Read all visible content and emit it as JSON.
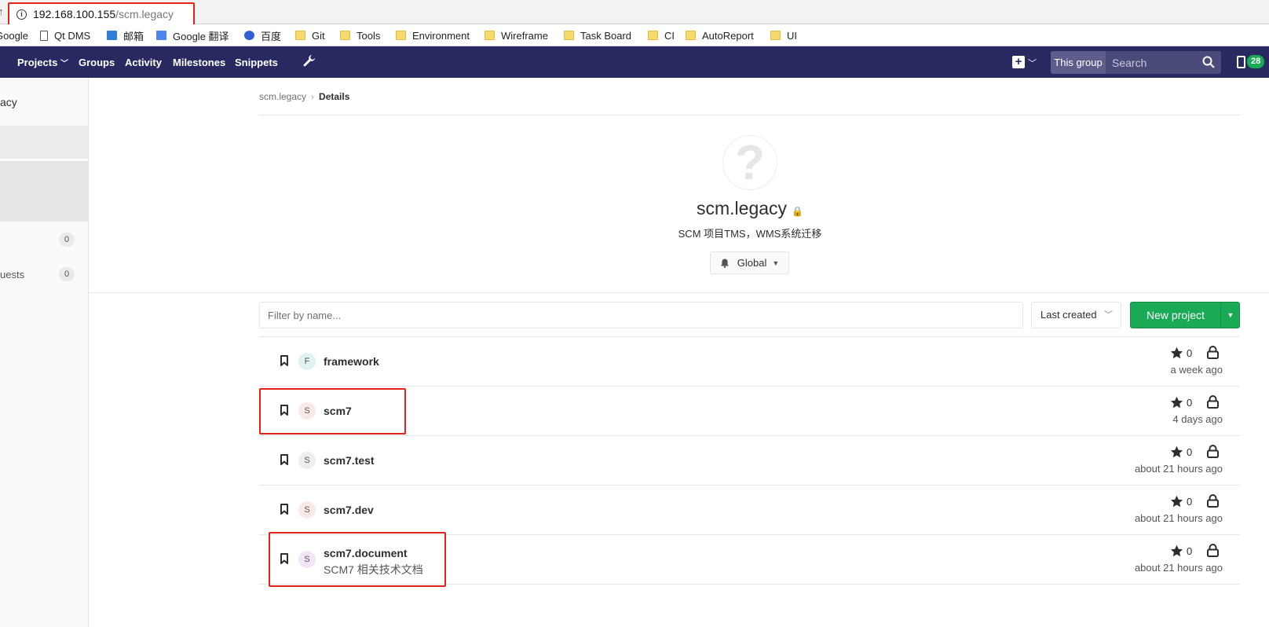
{
  "browser": {
    "url_host": "192.168.100.155",
    "url_path": "/scm.legacy",
    "info_icon": "info-icon",
    "bookmarks": [
      {
        "label": "Google",
        "icon": "page-icon"
      },
      {
        "label": "Qt DMS",
        "icon": "page-icon"
      },
      {
        "label": "邮箱",
        "icon": "mail-icon"
      },
      {
        "label": "Google 翻译",
        "icon": "google-translate-icon"
      },
      {
        "label": "百度",
        "icon": "baidu-icon"
      },
      {
        "label": "Git",
        "icon": "folder-icon"
      },
      {
        "label": "Tools",
        "icon": "folder-icon"
      },
      {
        "label": "Environment",
        "icon": "folder-icon"
      },
      {
        "label": "Wireframe",
        "icon": "folder-icon"
      },
      {
        "label": "Task Board",
        "icon": "folder-icon"
      },
      {
        "label": "CI",
        "icon": "folder-icon"
      },
      {
        "label": "AutoReport",
        "icon": "folder-icon"
      },
      {
        "label": "UI",
        "icon": "folder-icon"
      }
    ]
  },
  "navbar": {
    "projects": "Projects",
    "groups": "Groups",
    "activity": "Activity",
    "milestones": "Milestones",
    "snippets": "Snippets",
    "this_group": "This group",
    "search_placeholder": "Search",
    "todo_count": "28",
    "colors": {
      "bg": "#292961",
      "badge": "#1aaa55"
    }
  },
  "sidebar": {
    "title": "acy",
    "rows": [
      {
        "label": "",
        "count": "0"
      },
      {
        "label": "uests",
        "count": "0"
      }
    ]
  },
  "breadcrumb": {
    "group": "scm.legacy",
    "current": "Details"
  },
  "group": {
    "avatar_glyph": "?",
    "name": "scm.legacy",
    "lock": "🔒",
    "description": "SCM 项目TMS，WMS系统迁移",
    "notification": "Global"
  },
  "toolbar": {
    "filter_placeholder": "Filter by name...",
    "sort": "Last created",
    "new_project": "New project"
  },
  "projects": [
    {
      "initial": "F",
      "name": "framework",
      "description": "",
      "stars": "0",
      "updated": "a week ago",
      "avatar_color": "#e0f2f1"
    },
    {
      "initial": "S",
      "name": "scm7",
      "description": "",
      "stars": "0",
      "updated": "4 days ago",
      "avatar_color": "#fbe9e7"
    },
    {
      "initial": "S",
      "name": "scm7.test",
      "description": "",
      "stars": "0",
      "updated": "about 21 hours ago",
      "avatar_color": "#eeeeee"
    },
    {
      "initial": "S",
      "name": "scm7.dev",
      "description": "",
      "stars": "0",
      "updated": "about 21 hours ago",
      "avatar_color": "#fbe9e7"
    },
    {
      "initial": "S",
      "name": "scm7.document",
      "description": "SCM7 相关技术文档",
      "stars": "0",
      "updated": "about 21 hours ago",
      "avatar_color": "#f3e5f5"
    }
  ],
  "annotation_color": "#e2231a"
}
